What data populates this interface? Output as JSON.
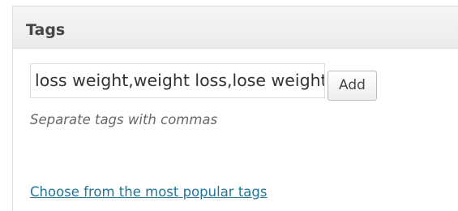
{
  "tags_box": {
    "title": "Tags",
    "input_value": "loss weight,weight loss,lose weight,",
    "add_label": "Add",
    "help_text": "Separate tags with commas",
    "popular_link": "Choose from the most popular tags"
  },
  "colors": {
    "header_background": "#ebebeb",
    "title_text": "#464646",
    "help_text": "#666666",
    "link": "#21759b"
  }
}
